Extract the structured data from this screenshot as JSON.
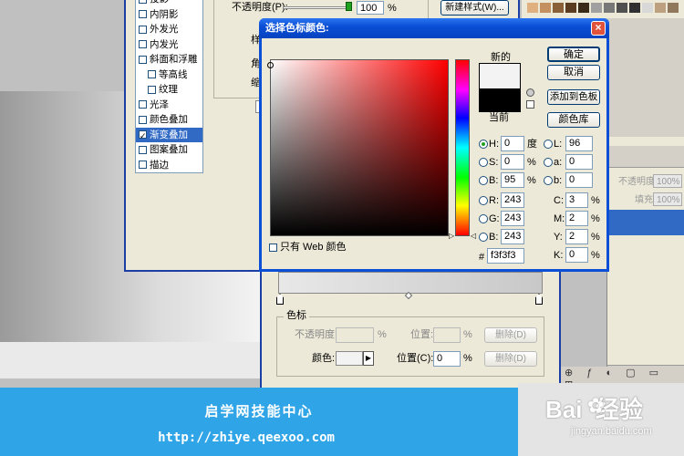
{
  "layer_style": {
    "items": [
      {
        "label": "投影",
        "checked": false
      },
      {
        "label": "内阴影",
        "checked": false
      },
      {
        "label": "外发光",
        "checked": false
      },
      {
        "label": "内发光",
        "checked": false
      },
      {
        "label": "斜面和浮雕",
        "checked": false
      },
      {
        "label": "等高线",
        "checked": false
      },
      {
        "label": "纹理",
        "checked": false
      },
      {
        "label": "光泽",
        "checked": false
      },
      {
        "label": "颜色叠加",
        "checked": false
      },
      {
        "label": "渐变叠加",
        "checked": true
      },
      {
        "label": "图案叠加",
        "checked": false
      },
      {
        "label": "描边",
        "checked": false
      }
    ],
    "opacity_label": "不透明度(P):",
    "opacity_value": "100",
    "opacity_unit": "%",
    "new_style_button": "新建样式(W)...",
    "side_label_1": "样",
    "side_label_2": "角",
    "side_label_3": "缩"
  },
  "gradient_editor": {
    "stops_group": "色标",
    "opacity_label": "不透明度:",
    "opacity_unit": "%",
    "position_label": "位置:",
    "position_unit": "%",
    "delete_button": "删除(D)",
    "color_label": "颜色:",
    "position_c_label": "位置(C):",
    "position_c_value": "0",
    "position_c_unit": "%",
    "delete_button_2": "删除(D)"
  },
  "color_picker": {
    "title": "选择色标颜色:",
    "new_label": "新的",
    "current_label": "当前",
    "new_color": "#f3f3f3",
    "current_color": "#000000",
    "ok_button": "确定",
    "cancel_button": "取消",
    "add_swatch_button": "添加到色板",
    "color_library_button": "颜色库",
    "fields": {
      "h": {
        "label": "H:",
        "value": "0",
        "unit": "度"
      },
      "s": {
        "label": "S:",
        "value": "0",
        "unit": "%"
      },
      "b": {
        "label": "B:",
        "value": "95",
        "unit": "%"
      },
      "r": {
        "label": "R:",
        "value": "243"
      },
      "g": {
        "label": "G:",
        "value": "243"
      },
      "bb": {
        "label": "B:",
        "value": "243"
      },
      "l": {
        "label": "L:",
        "value": "96"
      },
      "a": {
        "label": "a:",
        "value": "0"
      },
      "b2": {
        "label": "b:",
        "value": "0"
      },
      "c": {
        "label": "C:",
        "value": "3",
        "unit": "%"
      },
      "m": {
        "label": "M:",
        "value": "2",
        "unit": "%"
      },
      "y": {
        "label": "Y:",
        "value": "2",
        "unit": "%"
      },
      "k": {
        "label": "K:",
        "value": "0",
        "unit": "%"
      }
    },
    "hex_label": "#",
    "hex_value": "f3f3f3",
    "web_only_label": "只有 Web 颜色"
  },
  "layers_panel": {
    "opacity_label": "不透明度:",
    "opacity_value": "100%",
    "fill_label": "填充:",
    "fill_value": "100%"
  },
  "banner": {
    "title": "启学网技能中心",
    "url": "http://zhiye.qeexoo.com"
  },
  "watermark": {
    "brand": "Bai  经验",
    "url": "jingyan.baidu.com"
  }
}
